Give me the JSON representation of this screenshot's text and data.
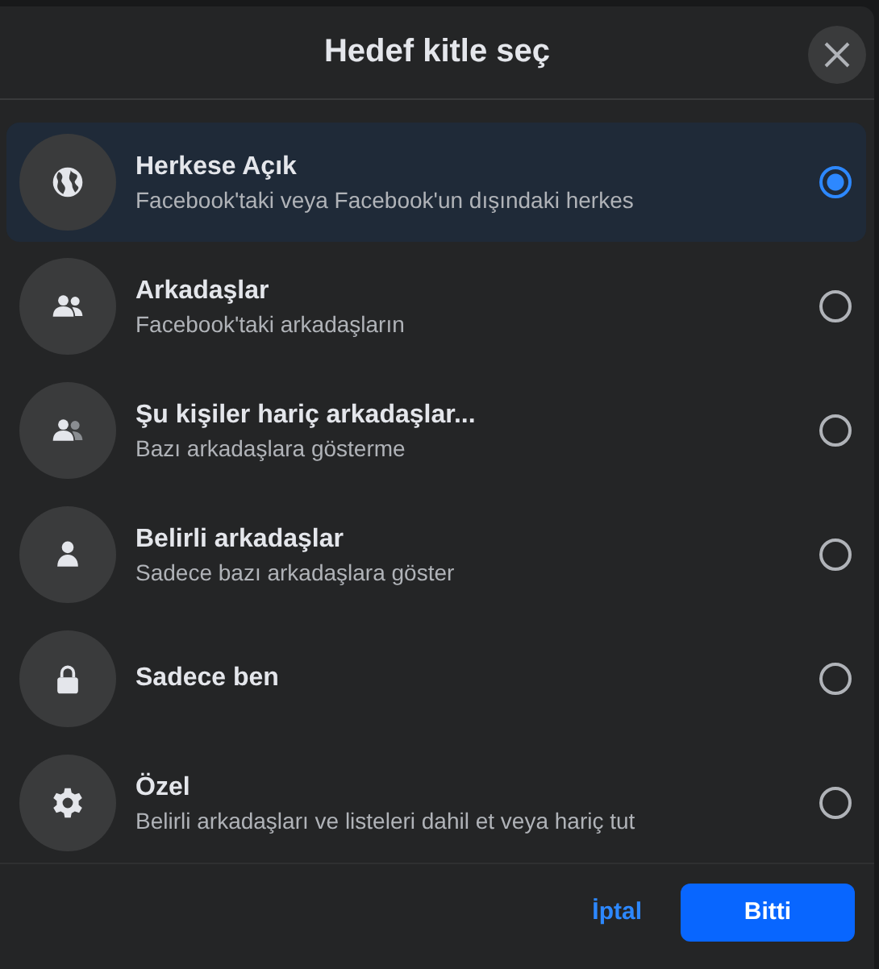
{
  "dialog": {
    "title": "Hedef kitle seç"
  },
  "options": [
    {
      "kind": "public",
      "title": "Herkese Açık",
      "subtitle": "Facebook'taki veya Facebook'un dışındaki herkes",
      "selected": true
    },
    {
      "kind": "friends",
      "title": "Arkadaşlar",
      "subtitle": "Facebook'taki arkadaşların",
      "selected": false
    },
    {
      "kind": "except",
      "title": "Şu kişiler hariç arkadaşlar...",
      "subtitle": "Bazı arkadaşlara gösterme",
      "selected": false
    },
    {
      "kind": "specific",
      "title": "Belirli arkadaşlar",
      "subtitle": "Sadece bazı arkadaşlara göster",
      "selected": false
    },
    {
      "kind": "private",
      "title": "Sadece ben",
      "selected": false
    },
    {
      "kind": "custom",
      "title": "Özel",
      "subtitle": "Belirli arkadaşları ve listeleri dahil et veya hariç tut",
      "selected": false
    }
  ],
  "buttons": {
    "cancel": "İptal",
    "done": "Bitti"
  }
}
